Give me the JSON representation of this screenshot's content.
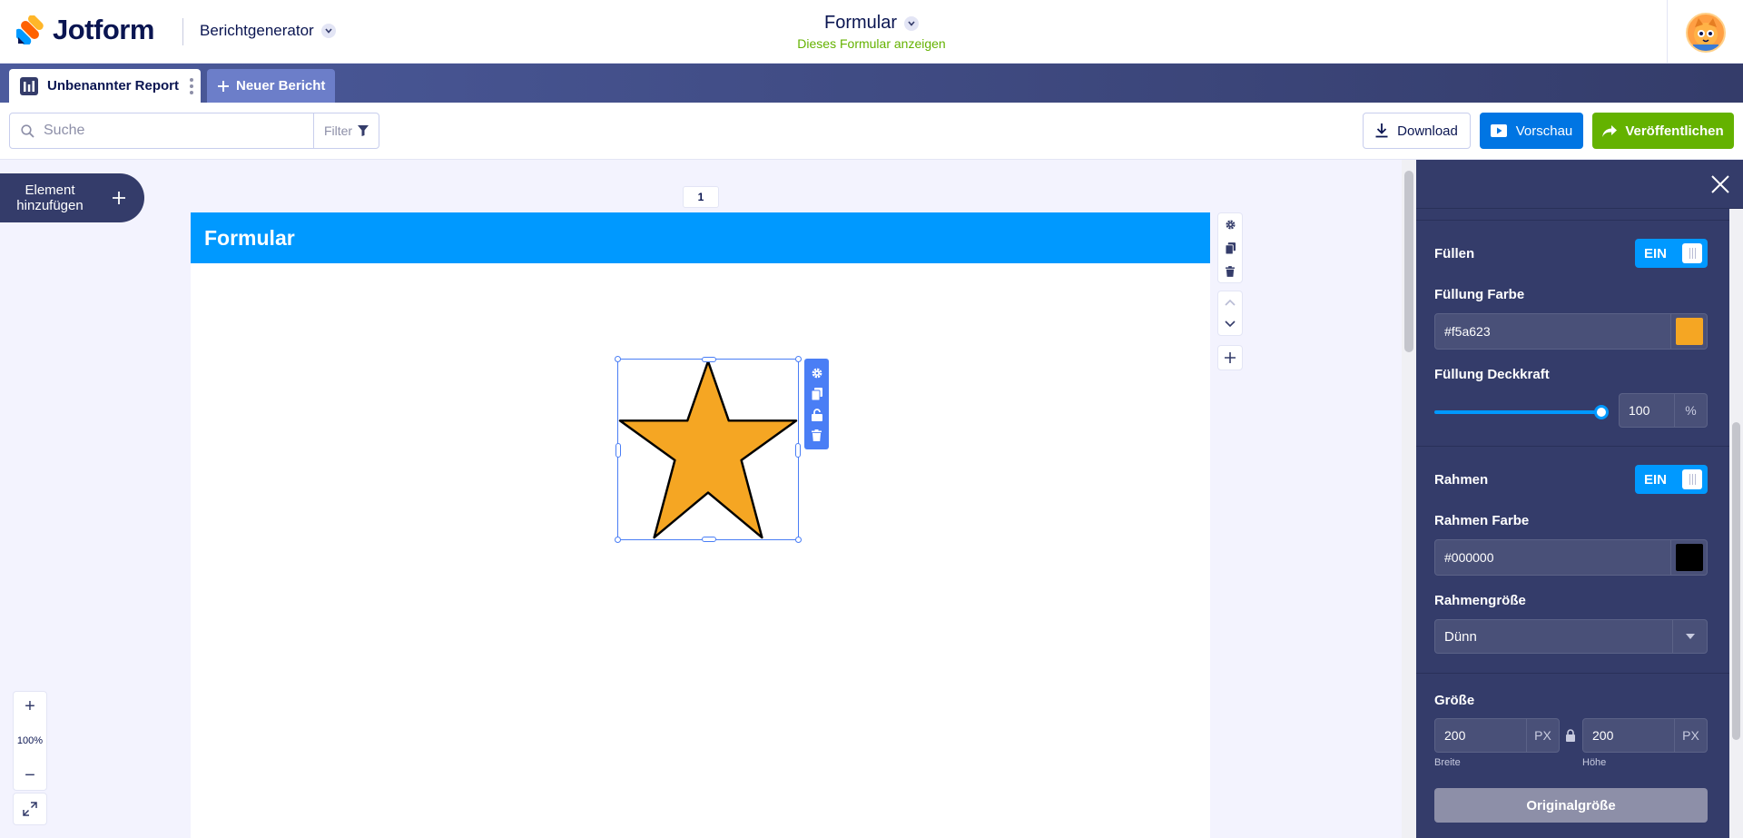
{
  "header": {
    "logo_text": "Jotform",
    "app_name": "Berichtgenerator",
    "form_title": "Formular",
    "form_view_link": "Dieses Formular anzeigen"
  },
  "tabs": {
    "active_label": "Unbenannter Report",
    "new_label": "Neuer Bericht"
  },
  "toolbar": {
    "search_placeholder": "Suche",
    "filter_label": "Filter",
    "download_label": "Download",
    "preview_label": "Vorschau",
    "publish_label": "Veröffentlichen"
  },
  "canvas": {
    "add_element_label": "Element hinzufügen",
    "page_number": "1",
    "page_title": "Formular",
    "zoom_level": "100%",
    "star_fill": "#f5a623",
    "star_stroke": "#000000"
  },
  "panel": {
    "fill_label": "Füllen",
    "fill_toggle": "EIN",
    "fill_color_label": "Füllung Farbe",
    "fill_color_value": "#f5a623",
    "fill_opacity_label": "Füllung Deckkraft",
    "fill_opacity_value": "100",
    "fill_opacity_unit": "%",
    "border_label": "Rahmen",
    "border_toggle": "EIN",
    "border_color_label": "Rahmen Farbe",
    "border_color_value": "#000000",
    "border_size_label": "Rahmengröße",
    "border_size_value": "Dünn",
    "size_label": "Größe",
    "width_value": "200",
    "width_unit": "PX",
    "width_label": "Breite",
    "height_value": "200",
    "height_unit": "PX",
    "height_label": "Höhe",
    "original_size_button": "Originalgröße"
  },
  "colors": {
    "accent_blue": "#0099ff",
    "publish_green": "#64b200",
    "preview_blue": "#0075e3",
    "navy": "#343c6a"
  }
}
